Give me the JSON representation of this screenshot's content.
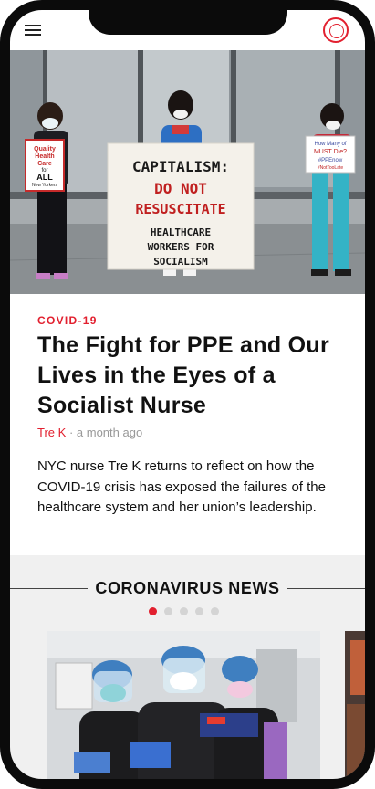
{
  "header": {
    "menu_icon": "hamburger-menu-icon",
    "logo_icon": "round-seal-logo-icon"
  },
  "hero": {
    "signs": {
      "left": [
        "Quality",
        "Health",
        "Care",
        "for",
        "ALL",
        "New Yorkers"
      ],
      "banner": [
        "CAPITALISM:",
        "DO NOT",
        "RESUSCITATE",
        "HEALTHCARE",
        "WORKERS FOR",
        "SOCIALISM"
      ],
      "right": [
        "How Many of",
        "MUST Die?",
        "#PPEnow",
        "#NotTooLate"
      ]
    }
  },
  "article": {
    "category": "COVID-19",
    "headline": "The Fight for PPE and Our Lives in the Eyes of a Socialist Nurse",
    "author": "Tre K",
    "separator": "·",
    "time": "a month ago",
    "summary": "NYC nurse Tre K returns to reflect on how the COVID-19 crisis has exposed the failures of the healthcare system and her union’s leadership."
  },
  "news": {
    "title": "CORONAVIRUS NEWS",
    "carousel_total": 5,
    "carousel_active": 1
  },
  "colors": {
    "accent": "#e2202f",
    "text": "#111111",
    "muted": "#999999",
    "section_bg": "#f0f0f0"
  }
}
